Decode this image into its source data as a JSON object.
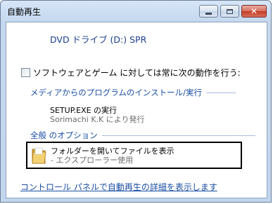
{
  "window": {
    "title": "自動再生"
  },
  "titlebar": {
    "minimize_icon": "minimize-icon",
    "maximize_icon": "maximize-icon",
    "close_icon": "close-icon",
    "close_glyph": "✕"
  },
  "device": {
    "label": "DVD ドライブ (D:) SPR"
  },
  "always": {
    "label": "ソフトウェアとゲーム に対しては常に次の動作を行う:",
    "checked": false
  },
  "install_section": {
    "heading": "メディアからのプログラムのインストール/実行",
    "option": {
      "title": "SETUP.EXE の実行",
      "subtitle": "Sorimachi K.K により発行"
    }
  },
  "general_section": {
    "heading": "全般 のオプション",
    "option": {
      "title": "フォルダーを開いてファイルを表示",
      "subtitle": "- エクスプローラー使用",
      "icon": "folder-icon"
    }
  },
  "footer": {
    "link": "コントロール パネルで自動再生の詳細を表示します"
  },
  "colors": {
    "link": "#1a4ea2",
    "device_text": "#1a3f8c",
    "close_button": "#c33b23"
  }
}
